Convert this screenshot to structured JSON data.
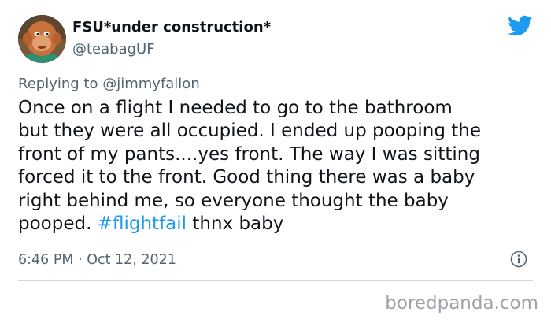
{
  "tweet": {
    "display_name": "FSU*under construction*",
    "handle": "@teabagUF",
    "replying_prefix": "Replying to",
    "replying_mention": "@jimmyfallon",
    "text_lines": [
      "Once on a flight I needed to go to the bathroom",
      "but they were all occupied. I ended up pooping the",
      "front of my pants....yes front. The way I was sitting",
      "forced it to the front. Good thing there was a baby",
      "right behind me, so everyone thought the baby"
    ],
    "last_line_prefix": "pooped. ",
    "hashtag": "#flightfail",
    "last_line_suffix": " thnx baby",
    "timestamp": "6:46 PM · Oct 12, 2021"
  },
  "icons": {
    "brand": "twitter-bird-icon",
    "info": "info-icon",
    "avatar": "monkey-avatar"
  },
  "watermark": "boredpanda.com",
  "colors": {
    "brand_blue": "#1d9bf0",
    "text": "#0f1419",
    "secondary": "#536471",
    "divider": "#cfd9de",
    "watermark": "#9ea3a7"
  }
}
